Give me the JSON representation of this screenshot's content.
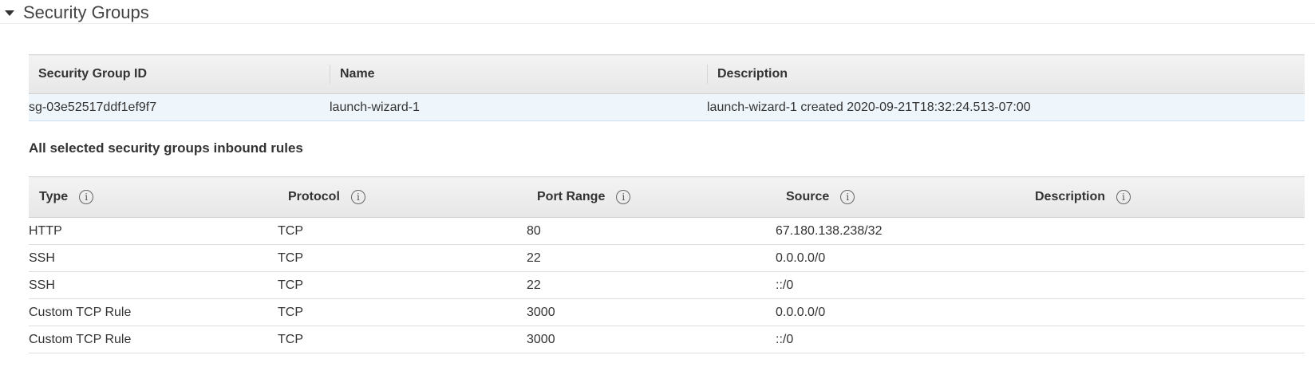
{
  "section": {
    "title": "Security Groups"
  },
  "security_groups_table": {
    "columns": [
      "Security Group ID",
      "Name",
      "Description"
    ],
    "rows": [
      {
        "id": "sg-03e52517ddf1ef9f7",
        "name": "launch-wizard-1",
        "description": "launch-wizard-1 created 2020-09-21T18:32:24.513-07:00"
      }
    ]
  },
  "inbound_rules": {
    "heading": "All selected security groups inbound rules",
    "columns": [
      "Type",
      "Protocol",
      "Port Range",
      "Source",
      "Description"
    ],
    "info_glyph": "i",
    "rows": [
      {
        "type": "HTTP",
        "protocol": "TCP",
        "port_range": "80",
        "source": "67.180.138.238/32",
        "description": ""
      },
      {
        "type": "SSH",
        "protocol": "TCP",
        "port_range": "22",
        "source": "0.0.0.0/0",
        "description": ""
      },
      {
        "type": "SSH",
        "protocol": "TCP",
        "port_range": "22",
        "source": "::/0",
        "description": ""
      },
      {
        "type": "Custom TCP Rule",
        "protocol": "TCP",
        "port_range": "3000",
        "source": "0.0.0.0/0",
        "description": ""
      },
      {
        "type": "Custom TCP Rule",
        "protocol": "TCP",
        "port_range": "3000",
        "source": "::/0",
        "description": ""
      }
    ]
  },
  "colors": {
    "selected_row": "#eef6fc",
    "header_bg": "#eaeaea",
    "text": "#333333"
  },
  "icons": {
    "collapse": "caret-down-icon",
    "info": "info-icon"
  }
}
